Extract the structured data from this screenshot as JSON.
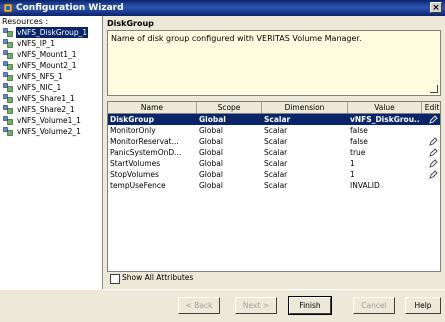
{
  "window": {
    "title": "Configuration Wizard",
    "close_glyph": "×"
  },
  "resources": {
    "heading": "Resources :",
    "items": [
      {
        "label": "vNFS_DiskGroup_1",
        "icon": "disk-icon",
        "selected": true
      },
      {
        "label": "vNFS_IP_1",
        "icon": "ip-icon"
      },
      {
        "label": "vNFS_Mount1_1",
        "icon": "mount-icon"
      },
      {
        "label": "vNFS_Mount2_1",
        "icon": "mount-icon"
      },
      {
        "label": "vNFS_NFS_1",
        "icon": "nfs-icon"
      },
      {
        "label": "vNFS_NIC_1",
        "icon": "nic-icon"
      },
      {
        "label": "vNFS_Share1_1",
        "icon": "share-icon"
      },
      {
        "label": "vNFS_Share2_1",
        "icon": "share-icon"
      },
      {
        "label": "vNFS_Volume1_1",
        "icon": "volume-icon"
      },
      {
        "label": "vNFS_Volume2_1",
        "icon": "volume-icon"
      }
    ]
  },
  "detail": {
    "title": "DiskGroup",
    "description": "Name of disk group configured with VERITAS Volume Manager."
  },
  "table": {
    "columns": [
      "Name",
      "Scope",
      "Dimension",
      "Value",
      "Edit"
    ],
    "rows": [
      {
        "name": "DiskGroup",
        "scope": "Global",
        "dimension": "Scalar",
        "value": "vNFS_DiskGrou...",
        "edit": true,
        "selected": true
      },
      {
        "name": "MonitorOnly",
        "scope": "Global",
        "dimension": "Scalar",
        "value": "false",
        "edit": false
      },
      {
        "name": "MonitorReservat...",
        "scope": "Global",
        "dimension": "Scalar",
        "value": "false",
        "edit": true
      },
      {
        "name": "PanicSystemOnD...",
        "scope": "Global",
        "dimension": "Scalar",
        "value": "true",
        "edit": true
      },
      {
        "name": "StartVolumes",
        "scope": "Global",
        "dimension": "Scalar",
        "value": "1",
        "edit": true
      },
      {
        "name": "StopVolumes",
        "scope": "Global",
        "dimension": "Scalar",
        "value": "1",
        "edit": true
      },
      {
        "name": "tempUseFence",
        "scope": "Global",
        "dimension": "Scalar",
        "value": "INVALID",
        "edit": false
      }
    ]
  },
  "show_all": {
    "label": "Show All Attributes",
    "checked": false
  },
  "buttons": {
    "back": "< Back",
    "next": "Next >",
    "finish": "Finish",
    "cancel": "Cancel",
    "help": "Help"
  },
  "colors": {
    "title_bar": "#0a246a",
    "selection": "#0a246a",
    "description_bg": "#fffde0"
  }
}
